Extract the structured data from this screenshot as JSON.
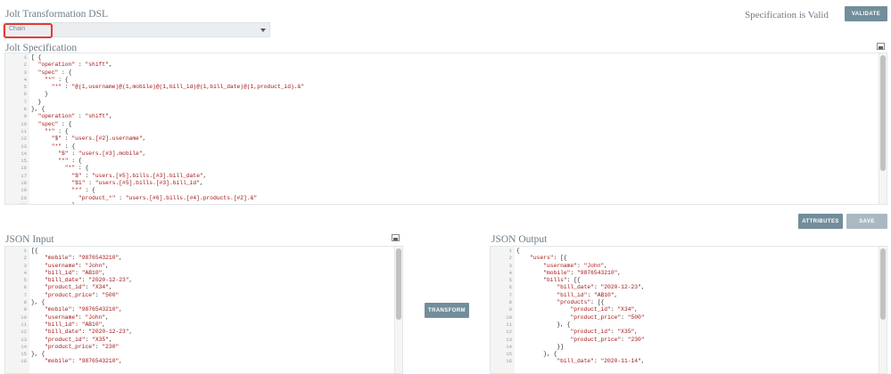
{
  "header": {
    "title": "Jolt Transformation DSL",
    "status": "Specification is Valid",
    "validate_label": "VALIDATE"
  },
  "dsl_select": {
    "value": "Chain"
  },
  "spec_panel": {
    "title": "Jolt Specification",
    "fullscreen_icon": "expand-icon",
    "lines": [
      "[ {",
      "  \"operation\" : \"shift\",",
      "  \"spec\" : {",
      "    \"*\" : {",
      "      \"*\" : \"@(1,username)@(1,mobile)@(1,bill_id)@(1,bill_date)@(1,product_id).&\"",
      "    }",
      "  }",
      "}, {",
      "  \"operation\" : \"shift\",",
      "  \"spec\" : {",
      "    \"*\" : {",
      "      \"$\" : \"users.[#2].username\",",
      "      \"*\" : {",
      "        \"$\" : \"users.[#3].mobile\",",
      "        \"*\" : {",
      "          \"*\" : {",
      "            \"$\" : \"users.[#5].bills.[#3].bill_date\",",
      "            \"$1\" : \"users.[#5].bills.[#3].bill_id\",",
      "            \"*\" : {",
      "              \"product_*\" : \"users.[#6].bills.[#4].products.[#2].&\"",
      "            }"
    ]
  },
  "actions": {
    "attributes_label": "ATTRIBUTES",
    "save_label": "SAVE",
    "transform_label": "TRANSFORM"
  },
  "input_panel": {
    "title": "JSON Input",
    "fullscreen_icon": "expand-icon",
    "lines": [
      "[{",
      "    \"mobile\": \"9876543210\",",
      "    \"username\": \"John\",",
      "    \"bill_id\": \"AB10\",",
      "    \"bill_date\": \"2020-12-23\",",
      "    \"product_id\": \"X34\",",
      "    \"product_price\": \"500\"",
      "}, {",
      "    \"mobile\": \"9876543210\",",
      "    \"username\": \"John\",",
      "    \"bill_id\": \"AB10\",",
      "    \"bill_date\": \"2020-12-23\",",
      "    \"product_id\": \"X35\",",
      "    \"product_price\": \"230\"",
      "}, {",
      "    \"mobile\": \"9876543210\","
    ]
  },
  "output_panel": {
    "title": "JSON Output",
    "lines": [
      "{",
      "    \"users\": [{",
      "        \"username\": \"John\",",
      "        \"mobile\": \"9876543210\",",
      "        \"bills\": [{",
      "            \"bill_date\": \"2020-12-23\",",
      "            \"bill_id\": \"AB10\",",
      "            \"products\": [{",
      "                \"product_id\": \"X34\",",
      "                \"product_price\": \"500\"",
      "            }, {",
      "                \"product_id\": \"X35\",",
      "                \"product_price\": \"230\"",
      "            }]",
      "        }, {",
      "            \"bill_date\": \"2020-11-14\","
    ]
  }
}
